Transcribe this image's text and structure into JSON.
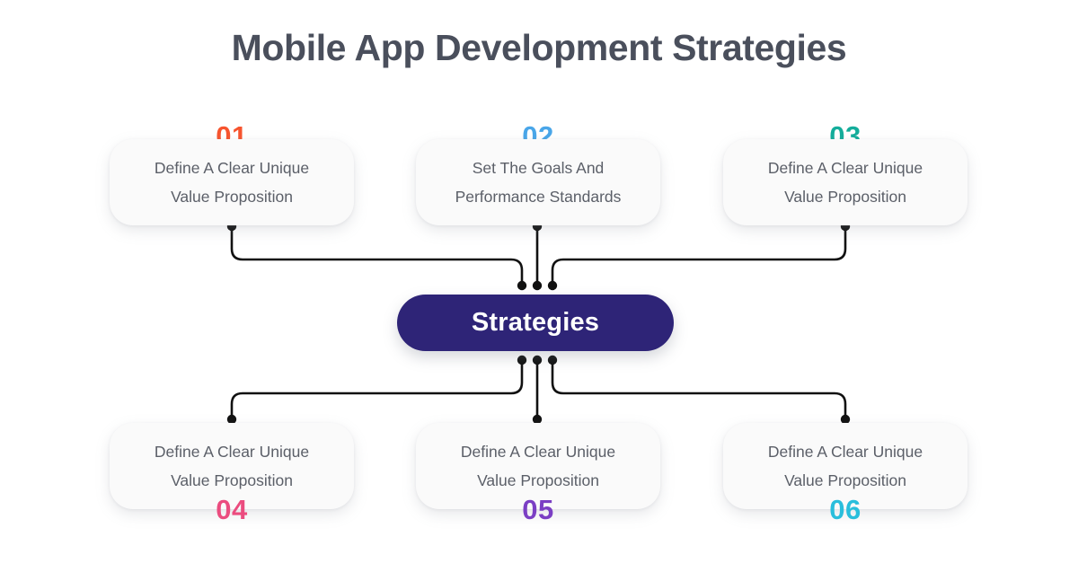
{
  "title": "Mobile App Development Strategies",
  "center": {
    "label": "Strategies",
    "color": "#2e2477"
  },
  "steps": [
    {
      "number": "01",
      "color": "#f7542e",
      "number_position": "above",
      "lines": [
        "Define A Clear Unique",
        "Value Proposition"
      ]
    },
    {
      "number": "02",
      "color": "#49a6e9",
      "number_position": "above",
      "lines": [
        "Set The Goals And",
        "Performance Standards"
      ]
    },
    {
      "number": "03",
      "color": "#14ad9b",
      "number_position": "above",
      "lines": [
        "Define A Clear Unique",
        "Value Proposition"
      ]
    },
    {
      "number": "04",
      "color": "#eb4c7f",
      "number_position": "below",
      "lines": [
        "Define A Clear Unique",
        "Value Proposition"
      ]
    },
    {
      "number": "05",
      "color": "#7b3fc4",
      "number_position": "below",
      "lines": [
        "Define A Clear Unique",
        "Value Proposition"
      ]
    },
    {
      "number": "06",
      "color": "#29bedc",
      "number_position": "below",
      "lines": [
        "Define A Clear Unique",
        "Value Proposition"
      ]
    }
  ],
  "connector": {
    "color": "#111111",
    "dot_color": "#111111"
  }
}
